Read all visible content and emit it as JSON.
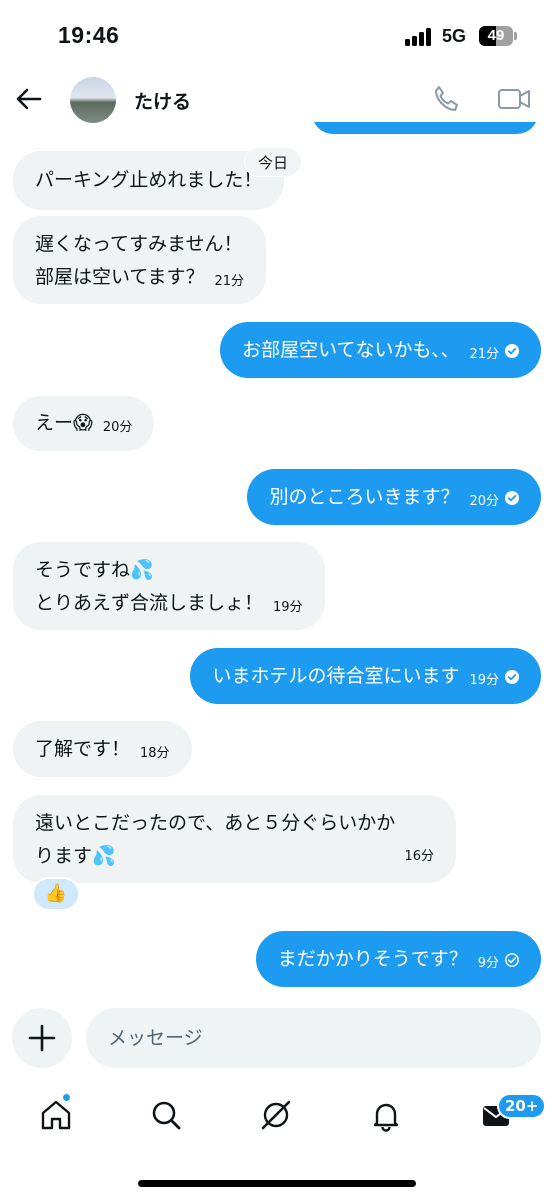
{
  "status_bar": {
    "time": "19:46",
    "network": "5G",
    "battery": "49",
    "battery_level_percent": 49
  },
  "header": {
    "contact_name": "たける",
    "icons": [
      "back-arrow-icon",
      "phone-icon",
      "video-camera-icon"
    ]
  },
  "date_label": "今日",
  "messages": [
    {
      "dir": "in",
      "lines": [
        "パーキング止めれました！"
      ],
      "time": ""
    },
    {
      "dir": "in",
      "lines": [
        "遅くなってすみません！",
        "部屋は空いてます？"
      ],
      "time": "21分"
    },
    {
      "dir": "out",
      "lines": [
        "お部屋空いてないかも、、"
      ],
      "time": "21分",
      "status": "read"
    },
    {
      "dir": "in",
      "lines": [
        "えー😱"
      ],
      "time": "20分"
    },
    {
      "dir": "out",
      "lines": [
        "別のところいきます？"
      ],
      "time": "20分",
      "status": "read"
    },
    {
      "dir": "in",
      "lines": [
        "そうですね💦",
        "とりあえず合流しましょ！"
      ],
      "time": "19分"
    },
    {
      "dir": "out",
      "lines": [
        "いまホテルの待合室にいます"
      ],
      "time": "19分",
      "status": "read"
    },
    {
      "dir": "in",
      "lines": [
        "了解です！"
      ],
      "time": "18分"
    },
    {
      "dir": "in",
      "lines": [
        "遠いとこだったので、あと５分ぐらいかか",
        "ります💦"
      ],
      "time": "16分",
      "reaction": "👍"
    },
    {
      "dir": "out",
      "lines": [
        "まだかかりそうです？"
      ],
      "time": "9分",
      "status": "sent"
    }
  ],
  "composer": {
    "placeholder": "メッセージ"
  },
  "bottom_nav": {
    "items": [
      "home-icon",
      "search-icon",
      "grok-icon",
      "notifications-bell-icon",
      "messages-mail-icon"
    ],
    "messages_badge": "20+"
  },
  "colors": {
    "accent": "#1d9bf0",
    "incoming_bubble": "#eff3f4",
    "text": "#0f1419"
  }
}
